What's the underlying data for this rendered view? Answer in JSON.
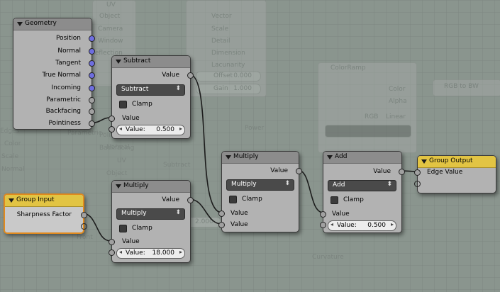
{
  "background": {
    "texts": [
      "UV",
      "Object",
      "Camera",
      "Window",
      "Reflection",
      "Vector",
      "Scale",
      "Detail",
      "Dimension",
      "Lacunarity",
      "Offset",
      "Gain",
      "0.000",
      "1.000",
      "ColorRamp",
      "Color",
      "Alpha",
      "RGB",
      "Linear",
      "RGB to BW",
      "Power",
      "Subtract",
      "Edges",
      "Color",
      "Scale",
      "Normal",
      "Parametric",
      "Pointiness",
      "Backfacing",
      "2.000",
      "Front",
      "Curvature",
      "Normal",
      "UV",
      "Object"
    ]
  },
  "nodes": {
    "geometry": {
      "title": "Geometry",
      "outputs": [
        "Position",
        "Normal",
        "Tangent",
        "True Normal",
        "Incoming",
        "Parametric",
        "Backfacing",
        "Pointiness"
      ]
    },
    "subtract": {
      "title": "Subtract",
      "output": "Value",
      "operation": "Subtract",
      "clamp_label": "Clamp",
      "input_label": "Value",
      "field_label": "Value:",
      "field_value": "0.500"
    },
    "multiply_bottom": {
      "title": "Multiply",
      "output": "Value",
      "operation": "Multiply",
      "clamp_label": "Clamp",
      "input_label": "Value",
      "field_label": "Value:",
      "field_value": "18.000"
    },
    "multiply_center": {
      "title": "Multiply",
      "output": "Value",
      "operation": "Multiply",
      "clamp_label": "Clamp",
      "input1_label": "Value",
      "input2_label": "Value"
    },
    "add": {
      "title": "Add",
      "output": "Value",
      "operation": "Add",
      "clamp_label": "Clamp",
      "input_label": "Value",
      "field_label": "Value:",
      "field_value": "0.500"
    },
    "group_input": {
      "title": "Group Input",
      "output": "Sharpness Factor"
    },
    "group_output": {
      "title": "Group Output",
      "input": "Edge Value"
    }
  },
  "colors": {
    "canvas": "#8a958e",
    "node_body": "#b2b2b2",
    "node_header": "#8c8c8c",
    "group_header": "#e2c443",
    "vector_socket": "#6e6ee0",
    "value_socket": "#a1a1a1",
    "wire": "#1c1c1c",
    "selection_outline": "#e08a1e"
  }
}
